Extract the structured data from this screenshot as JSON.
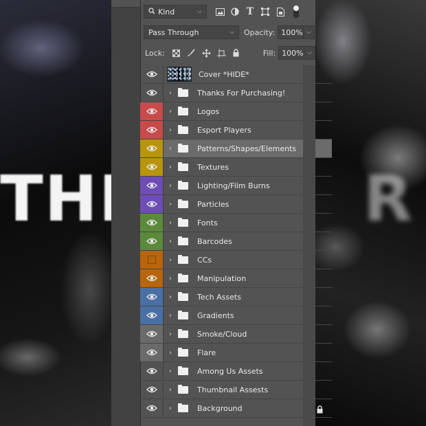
{
  "background": {
    "left_text": "THI",
    "right_text": "R"
  },
  "panel": {
    "filter": {
      "kind_label": "Kind"
    },
    "blend_mode": "Pass Through",
    "opacity": {
      "label": "Opacity:",
      "value": "100%"
    },
    "lock_label": "Lock:",
    "fill": {
      "label": "Fill:",
      "value": "100%"
    }
  },
  "layers": [
    {
      "name": "Cover *HIDE*",
      "color": "",
      "type": "image"
    },
    {
      "name": "Thanks For Purchasing!",
      "color": "",
      "type": "folder"
    },
    {
      "name": "Logos",
      "color": "#c94a4a",
      "type": "folder"
    },
    {
      "name": "Esport Players",
      "color": "#c94a4a",
      "type": "folder"
    },
    {
      "name": "Patterns/Shapes/Elements",
      "color": "#b8950c",
      "type": "folder",
      "selected": true
    },
    {
      "name": "Textures",
      "color": "#b8950c",
      "type": "folder"
    },
    {
      "name": "Lighting/Film Burns",
      "color": "#6e4db5",
      "type": "folder"
    },
    {
      "name": "Particles",
      "color": "#6e4db5",
      "type": "folder"
    },
    {
      "name": "Fonts",
      "color": "#5b8a3a",
      "type": "folder"
    },
    {
      "name": "Barcodes",
      "color": "#5b8a3a",
      "type": "folder"
    },
    {
      "name": "CCs",
      "color": "#b8650c",
      "type": "folder",
      "hidden": true
    },
    {
      "name": "Manipulation",
      "color": "#b8650c",
      "type": "folder"
    },
    {
      "name": "Tech Assets",
      "color": "#4a6fa5",
      "type": "folder"
    },
    {
      "name": "Gradients",
      "color": "#4a6fa5",
      "type": "folder"
    },
    {
      "name": "Smoke/Cloud",
      "color": "#6a6a6a",
      "type": "folder"
    },
    {
      "name": "Flare",
      "color": "#6a6a6a",
      "type": "folder"
    },
    {
      "name": "Among Us Assets",
      "color": "",
      "type": "folder"
    },
    {
      "name": "Thumbnail Assests",
      "color": "",
      "type": "folder"
    },
    {
      "name": "Background",
      "color": "",
      "type": "folder",
      "locked": true
    }
  ]
}
